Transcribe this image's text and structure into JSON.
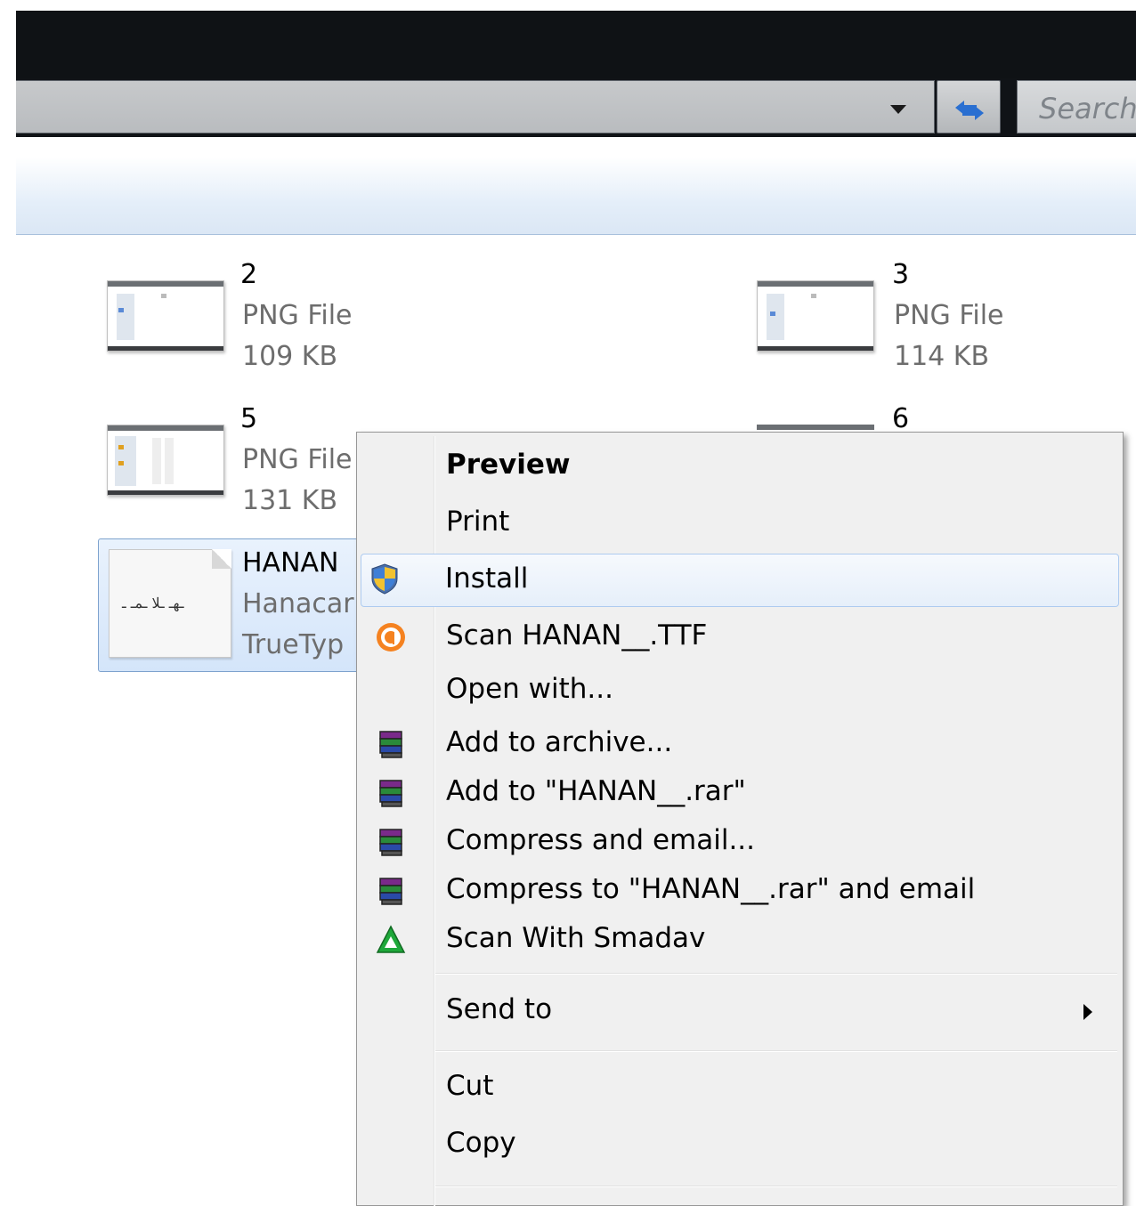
{
  "window": {
    "search_placeholder": "Search H"
  },
  "files": [
    {
      "name": "2",
      "type": "PNG File",
      "size": "109 KB"
    },
    {
      "name": "3",
      "type": "PNG File",
      "size": "114 KB"
    },
    {
      "name": "5",
      "type": "PNG File",
      "size": "131 KB"
    },
    {
      "name": "6"
    },
    {
      "name": "HANAN",
      "type": "Hanacar",
      "size": "TrueTyp",
      "sample": "ـهـ ـلا ـمـ ـ"
    }
  ],
  "context_menu": {
    "items": [
      {
        "label": "Preview",
        "bold": true
      },
      {
        "label": "Print"
      },
      {
        "label": "Install",
        "icon": "uac-shield-icon"
      },
      {
        "label": "Scan HANAN__.TTF",
        "icon": "avast-icon"
      },
      {
        "label": "Open with..."
      },
      {
        "label": "Add to archive...",
        "icon": "winrar-icon"
      },
      {
        "label": "Add to \"HANAN__.rar\"",
        "icon": "winrar-icon"
      },
      {
        "label": "Compress and email...",
        "icon": "winrar-icon"
      },
      {
        "label": "Compress to \"HANAN__.rar\" and email",
        "icon": "winrar-icon"
      },
      {
        "label": "Scan With Smadav",
        "icon": "smadav-icon"
      },
      {
        "label": "Send to"
      },
      {
        "label": "Cut"
      },
      {
        "label": "Copy"
      }
    ]
  },
  "colors": {
    "hover_border": "#aecbf0",
    "selection_border": "#7da2ce"
  }
}
